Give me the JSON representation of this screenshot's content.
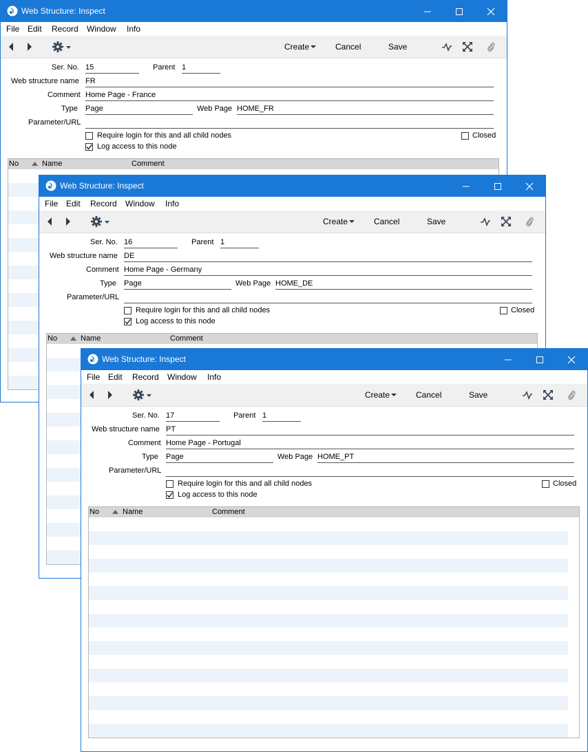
{
  "menu": [
    "File",
    "Edit",
    "Record",
    "Window",
    "Info"
  ],
  "toolbar": {
    "create": "Create",
    "cancel": "Cancel",
    "save": "Save"
  },
  "labels": {
    "ser_no": "Ser. No.",
    "parent": "Parent",
    "web_structure_name": "Web structure name",
    "comment": "Comment",
    "type": "Type",
    "web_page": "Web Page",
    "parameter_url": "Parameter/URL",
    "require_login": "Require login for this and all child nodes",
    "log_access": "Log access to this node",
    "closed": "Closed"
  },
  "grid_headers": {
    "no": "No",
    "name": "Name",
    "comment": "Comment"
  },
  "colors": {
    "titlebar": "#1a78d6",
    "toolbar": "#f0f0f0",
    "grid_header": "#d6d6d6",
    "stripe": "#edf3fb"
  },
  "windows": [
    {
      "title": "Web Structure: Inspect",
      "ser_no": "15",
      "parent": "1",
      "name": "FR",
      "comment": "Home Page - France",
      "type": "Page",
      "web_page": "HOME_FR",
      "parameter_url": "",
      "require_login": false,
      "log_access": true,
      "closed": false
    },
    {
      "title": "Web Structure: Inspect",
      "ser_no": "16",
      "parent": "1",
      "name": "DE",
      "comment": "Home Page - Germany",
      "type": "Page",
      "web_page": "HOME_DE",
      "parameter_url": "",
      "require_login": false,
      "log_access": true,
      "closed": false
    },
    {
      "title": "Web Structure: Inspect",
      "ser_no": "17",
      "parent": "1",
      "name": "PT",
      "comment": "Home Page - Portugal",
      "type": "Page",
      "web_page": "HOME_PT",
      "parameter_url": "",
      "require_login": false,
      "log_access": true,
      "closed": false
    }
  ]
}
